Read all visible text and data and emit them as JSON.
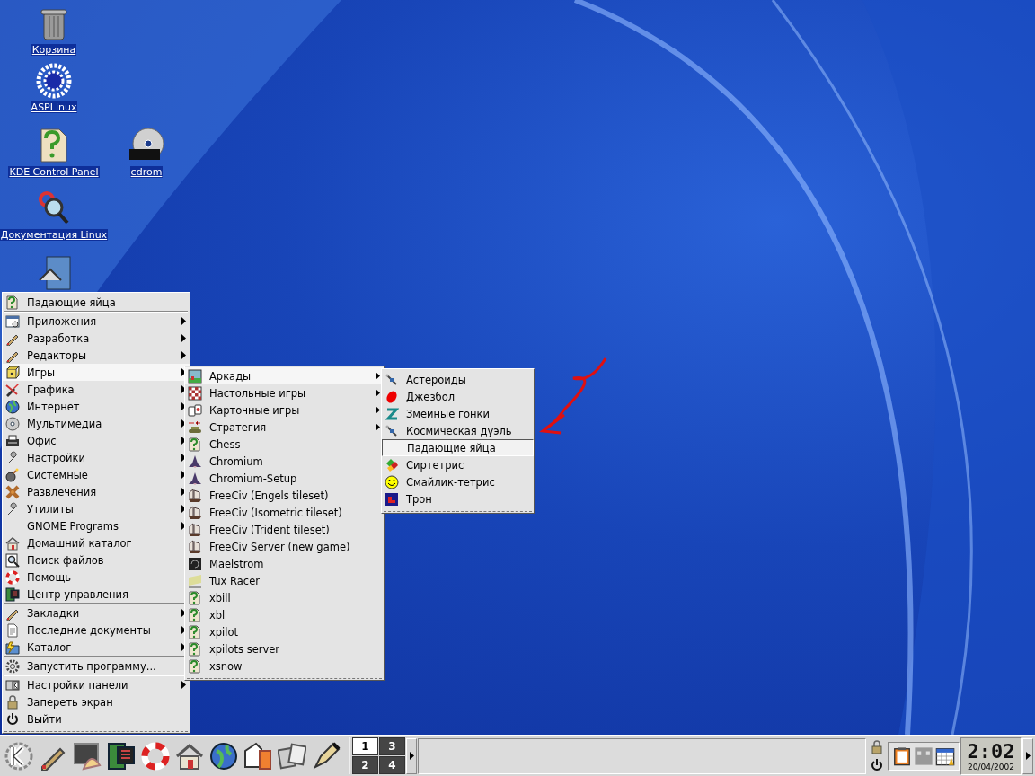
{
  "desktop_icons": [
    {
      "kind": "trash",
      "label": "Корзина"
    },
    {
      "kind": "asplinux",
      "label": "ASPLinux"
    },
    {
      "kind": "doc",
      "label": "KDE Control Panel"
    },
    {
      "kind": "disc",
      "label": "cdrom"
    },
    {
      "kind": "magnifier",
      "label": "Документация Linux"
    },
    {
      "kind": "home"
    }
  ],
  "start_menu": {
    "sections": [
      [
        {
          "label": "Падающие яйца",
          "submenu": false,
          "selected": false
        }
      ],
      [
        {
          "label": "Приложения",
          "submenu": true,
          "selected": false
        },
        {
          "label": "Разработка",
          "submenu": true,
          "selected": false
        },
        {
          "label": "Редакторы",
          "submenu": true,
          "selected": false
        },
        {
          "label": "Игры",
          "submenu": true,
          "selected": true
        },
        {
          "label": "Графика",
          "submenu": true,
          "selected": false
        },
        {
          "label": "Интернет",
          "submenu": true,
          "selected": false
        },
        {
          "label": "Мультимедиа",
          "submenu": true,
          "selected": false
        },
        {
          "label": "Офис",
          "submenu": true,
          "selected": false
        },
        {
          "label": "Настройки",
          "submenu": true,
          "selected": false
        },
        {
          "label": "Системные",
          "submenu": true,
          "selected": false
        },
        {
          "label": "Развлечения",
          "submenu": true,
          "selected": false
        },
        {
          "label": "Утилиты",
          "submenu": true,
          "selected": false
        },
        {
          "label": "GNOME Programs",
          "submenu": true,
          "selected": false
        },
        {
          "label": "Домашний каталог",
          "submenu": false,
          "selected": false
        },
        {
          "label": "Поиск файлов",
          "submenu": false,
          "selected": false
        },
        {
          "label": "Помощь",
          "submenu": false,
          "selected": false
        },
        {
          "label": "Центр управления",
          "submenu": false,
          "selected": false
        }
      ],
      [
        {
          "label": "Закладки",
          "submenu": true,
          "selected": false
        },
        {
          "label": "Последние документы",
          "submenu": true,
          "selected": false
        },
        {
          "label": "Каталог",
          "submenu": true,
          "selected": false
        }
      ],
      [
        {
          "label": "Запустить программу...",
          "submenu": false,
          "selected": false
        }
      ],
      [
        {
          "label": "Настройки панели",
          "submenu": true,
          "selected": false
        },
        {
          "label": "Запереть экран",
          "submenu": false,
          "selected": false
        },
        {
          "label": "Выйти",
          "submenu": false,
          "selected": false
        }
      ]
    ]
  },
  "games_menu": {
    "items": [
      {
        "label": "Аркады",
        "submenu": true,
        "selected": true
      },
      {
        "label": "Настольные игры",
        "submenu": true,
        "selected": false
      },
      {
        "label": "Карточные игры",
        "submenu": true,
        "selected": false
      },
      {
        "label": "Стратегия",
        "submenu": true,
        "selected": false
      },
      {
        "label": "Chess",
        "submenu": false,
        "selected": false
      },
      {
        "label": "Chromium",
        "submenu": false,
        "selected": false
      },
      {
        "label": "Chromium-Setup",
        "submenu": false,
        "selected": false
      },
      {
        "label": "FreeCiv (Engels tileset)",
        "submenu": false,
        "selected": false
      },
      {
        "label": "FreeCiv (Isometric tileset)",
        "submenu": false,
        "selected": false
      },
      {
        "label": "FreeCiv (Trident tileset)",
        "submenu": false,
        "selected": false
      },
      {
        "label": "FreeCiv Server (new game)",
        "submenu": false,
        "selected": false
      },
      {
        "label": "Maelstrom",
        "submenu": false,
        "selected": false
      },
      {
        "label": "Tux Racer",
        "submenu": false,
        "selected": false
      },
      {
        "label": "xbill",
        "submenu": false,
        "selected": false
      },
      {
        "label": "xbl",
        "submenu": false,
        "selected": false
      },
      {
        "label": "xpilot",
        "submenu": false,
        "selected": false
      },
      {
        "label": "xpilots server",
        "submenu": false,
        "selected": false
      },
      {
        "label": "xsnow",
        "submenu": false,
        "selected": false
      }
    ]
  },
  "arcade_menu": {
    "items": [
      {
        "label": "Астероиды",
        "submenu": false,
        "selected": false
      },
      {
        "label": "Джезбол",
        "submenu": false,
        "selected": false
      },
      {
        "label": "Змеиные гонки",
        "submenu": false,
        "selected": false
      },
      {
        "label": "Космическая дуэль",
        "submenu": false,
        "selected": false
      },
      {
        "label": "Падающие яйца",
        "submenu": false,
        "selected": true
      },
      {
        "label": "Сиртетрис",
        "submenu": false,
        "selected": false
      },
      {
        "label": "Смайлик-тетрис",
        "submenu": false,
        "selected": false
      },
      {
        "label": "Трон",
        "submenu": false,
        "selected": false
      }
    ]
  },
  "taskbar": {
    "launchers": [
      {
        "kind": "kde"
      },
      {
        "kind": "pencil"
      },
      {
        "kind": "shell"
      },
      {
        "kind": "monitor"
      },
      {
        "kind": "lifebuoy"
      },
      {
        "kind": "home"
      },
      {
        "kind": "globe"
      },
      {
        "kind": "mail"
      },
      {
        "kind": "files"
      },
      {
        "kind": "pen"
      }
    ],
    "desktops": [
      {
        "label": "1",
        "selected": true
      },
      {
        "label": "2",
        "selected": false
      },
      {
        "label": "3",
        "selected": false
      },
      {
        "label": "4",
        "selected": false
      }
    ],
    "clock": {
      "time": "2:02",
      "date": "20/04/2002"
    }
  }
}
